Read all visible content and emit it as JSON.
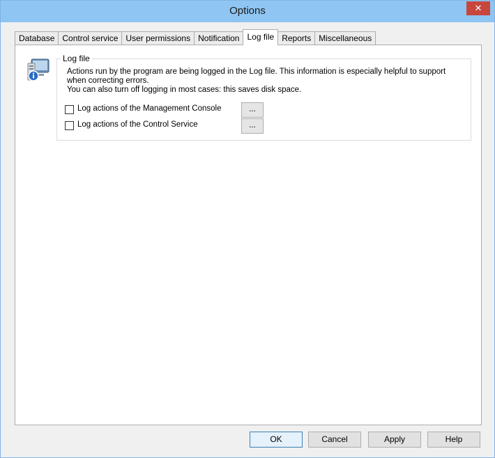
{
  "window": {
    "title": "Options",
    "close_glyph": "✕"
  },
  "tabs": [
    {
      "label": "Database"
    },
    {
      "label": "Control service"
    },
    {
      "label": "User permissions"
    },
    {
      "label": "Notification"
    },
    {
      "label": "Log file",
      "active": true
    },
    {
      "label": "Reports"
    },
    {
      "label": "Miscellaneous"
    }
  ],
  "logfile": {
    "group_title": "Log file",
    "info_line1": "Actions run by the program are being logged in the Log file. This information is especially helpful to support when correcting errors.",
    "info_line2": "You can also turn off logging in most cases: this saves disk space.",
    "options": [
      {
        "label": "Log actions of the Management Console",
        "checked": false,
        "button_label": "..."
      },
      {
        "label": "Log actions of the Control Service",
        "checked": false,
        "button_label": "..."
      }
    ]
  },
  "footer": {
    "ok_label": "OK",
    "cancel_label": "Cancel",
    "apply_label": "Apply",
    "help_label": "Help"
  },
  "icons": {
    "panel_icon": "computer-info-icon"
  }
}
